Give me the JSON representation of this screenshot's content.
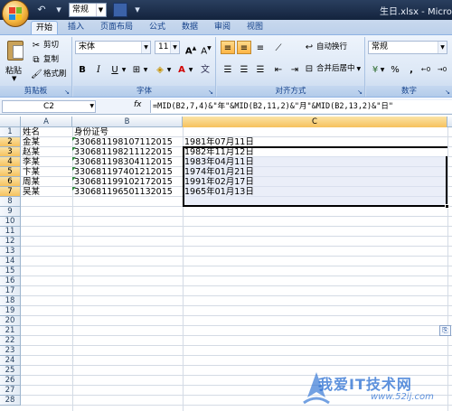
{
  "window": {
    "title": "生日.xlsx - Microsoft"
  },
  "qat": {
    "style_value": "常规"
  },
  "tabs": [
    "开始",
    "插入",
    "页面布局",
    "公式",
    "数据",
    "审阅",
    "视图"
  ],
  "clipboard": {
    "paste": "粘贴",
    "cut": "剪切",
    "copy": "复制",
    "format_painter": "格式刷",
    "label": "剪贴板"
  },
  "font": {
    "name": "宋体",
    "size": "11",
    "bold": "B",
    "italic": "I",
    "underline": "U",
    "label": "字体"
  },
  "alignment": {
    "wrap": "自动换行",
    "merge": "合并后居中",
    "label": "对齐方式"
  },
  "number": {
    "format": "常规",
    "percent": "%",
    "comma": ",",
    "label": "数字"
  },
  "formula_bar": {
    "name_box": "C2",
    "fx": "fx",
    "formula": "=MID(B2,7,4)&\"年\"&MID(B2,11,2)&\"月\"&MID(B2,13,2)&\"日\""
  },
  "columns": [
    "A",
    "B",
    "C"
  ],
  "rows": [
    "1",
    "2",
    "3",
    "4",
    "5",
    "6",
    "7",
    "8",
    "9",
    "10",
    "11",
    "12",
    "13",
    "14",
    "15",
    "16",
    "17",
    "18",
    "19",
    "20",
    "21",
    "22",
    "23",
    "24",
    "25",
    "26",
    "27",
    "28"
  ],
  "sheet": {
    "header": [
      "姓名",
      "身份证号"
    ],
    "records": [
      {
        "name": "金某",
        "id": "330681198107112015",
        "birthday": "1981年07月11日"
      },
      {
        "name": "赵某",
        "id": "330681198211122015",
        "birthday": "1982年11月12日"
      },
      {
        "name": "李某",
        "id": "330681198304112015",
        "birthday": "1983年04月11日"
      },
      {
        "name": "卞某",
        "id": "330681197401212015",
        "birthday": "1974年01月21日"
      },
      {
        "name": "周某",
        "id": "330681199102172015",
        "birthday": "1991年02月17日"
      },
      {
        "name": "吴某",
        "id": "330681196501132015",
        "birthday": "1965年01月13日"
      }
    ]
  },
  "watermark": {
    "text": "我爱IT技术网",
    "url": "www.52ij.com"
  }
}
